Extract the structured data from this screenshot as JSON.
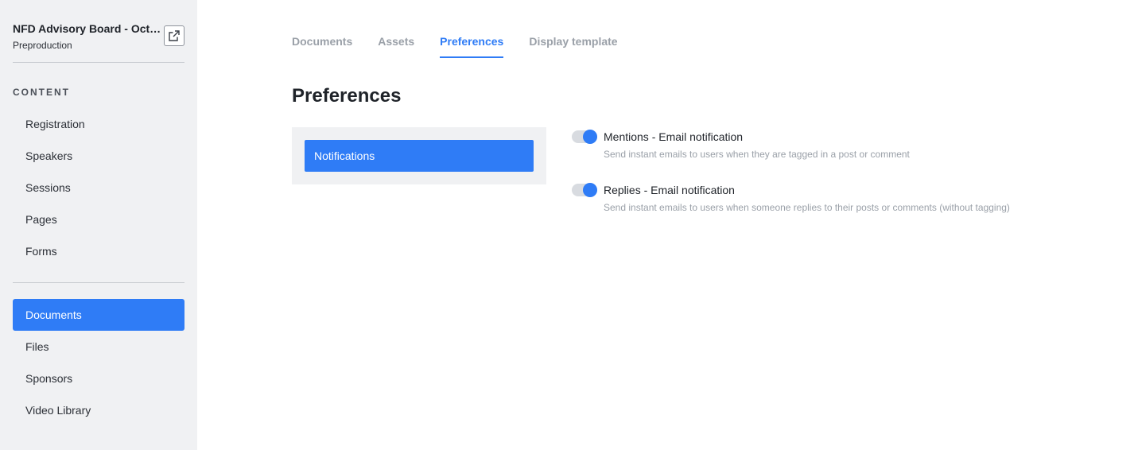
{
  "project": {
    "title": "NFD Advisory Board - October",
    "subtitle": "Preproduction",
    "open_external_icon": "external-link-icon"
  },
  "sidebar": {
    "section_label": "CONTENT",
    "content_items": [
      {
        "label": "Registration"
      },
      {
        "label": "Speakers"
      },
      {
        "label": "Sessions"
      },
      {
        "label": "Pages"
      },
      {
        "label": "Forms"
      }
    ],
    "library_items": [
      {
        "label": "Documents",
        "active": true
      },
      {
        "label": "Files"
      },
      {
        "label": "Sponsors"
      },
      {
        "label": "Video Library"
      }
    ]
  },
  "tabs": [
    {
      "label": "Documents"
    },
    {
      "label": "Assets"
    },
    {
      "label": "Preferences",
      "active": true
    },
    {
      "label": "Display template"
    }
  ],
  "main": {
    "title": "Preferences",
    "categories": [
      {
        "label": "Notifications",
        "active": true
      }
    ],
    "settings": [
      {
        "label": "Mentions - Email notification",
        "description": "Send instant emails to users when they are tagged in a post or comment",
        "enabled": true
      },
      {
        "label": "Replies - Email notification",
        "description": "Send instant emails to users when someone replies to their posts or comments (without tagging)",
        "enabled": true
      }
    ]
  },
  "colors": {
    "accent": "#2f7cf6",
    "sidebar_bg": "#f0f1f3",
    "muted_text": "#9aa0a8"
  }
}
